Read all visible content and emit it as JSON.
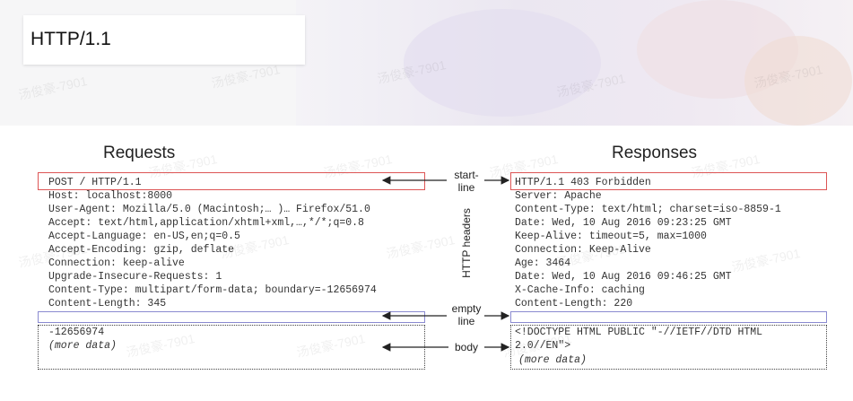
{
  "slide_title": "HTTP/1.1",
  "requests": {
    "heading": "Requests",
    "start_line": "POST / HTTP/1.1",
    "headers": [
      "Host: localhost:8000",
      "User-Agent: Mozilla/5.0 (Macintosh;… )… Firefox/51.0",
      "Accept: text/html,application/xhtml+xml,…,*/*;q=0.8",
      "Accept-Language: en-US,en;q=0.5",
      "Accept-Encoding: gzip, deflate",
      "Connection: keep-alive",
      "Upgrade-Insecure-Requests: 1",
      "Content-Type: multipart/form-data; boundary=-12656974",
      "Content-Length: 345"
    ],
    "body": [
      "-12656974",
      "(more data)"
    ]
  },
  "responses": {
    "heading": "Responses",
    "start_line": "HTTP/1.1 403 Forbidden",
    "headers": [
      "Server: Apache",
      "Content-Type: text/html; charset=iso-8859-1",
      "Date: Wed, 10 Aug 2016 09:23:25 GMT",
      "Keep-Alive: timeout=5, max=1000",
      "Connection: Keep-Alive",
      "Age: 3464",
      "Date: Wed, 10 Aug 2016 09:46:25 GMT",
      "X-Cache-Info: caching",
      "Content-Length: 220"
    ],
    "body": [
      "<!DOCTYPE HTML PUBLIC \"-//IETF//DTD HTML",
      "2.0//EN\">",
      "(more data)"
    ]
  },
  "labels": {
    "start_line": [
      "start-",
      "line"
    ],
    "http_headers": "HTTP headers",
    "empty_line": [
      "empty",
      "line"
    ],
    "body": "body"
  },
  "watermark": "汤俊豪-7901"
}
